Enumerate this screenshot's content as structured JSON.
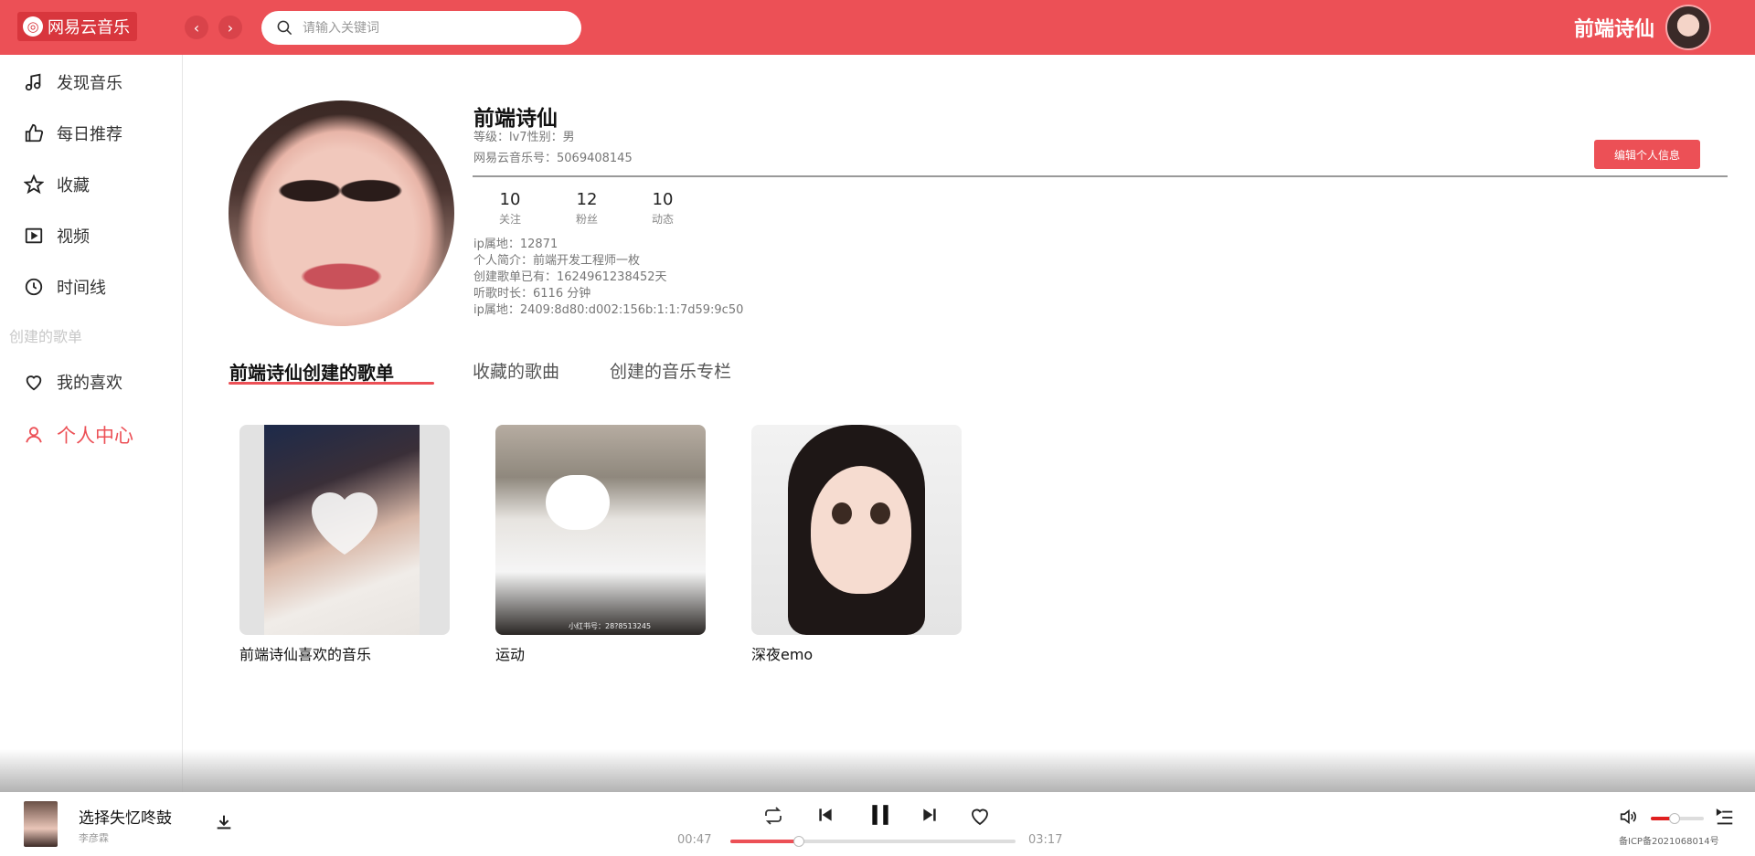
{
  "header": {
    "app_name": "网易云音乐",
    "search_placeholder": "请输入关键词",
    "username": "前端诗仙"
  },
  "sidebar": {
    "items": [
      {
        "label": "发现音乐",
        "icon": "music-note-icon"
      },
      {
        "label": "每日推荐",
        "icon": "thumbs-up-icon"
      },
      {
        "label": "收藏",
        "icon": "star-icon"
      },
      {
        "label": "视频",
        "icon": "video-icon"
      },
      {
        "label": "时间线",
        "icon": "clock-icon"
      }
    ],
    "section_title": "创建的歌单",
    "playlists": [
      {
        "label": "我的喜欢",
        "icon": "heart-icon"
      },
      {
        "label": "个人中心",
        "icon": "user-icon",
        "active": true
      }
    ]
  },
  "profile": {
    "name": "前端诗仙",
    "level_gender": "等级：lv7性别：男",
    "account_id": "网易云音乐号：5069408145",
    "edit_button": "编辑个人信息",
    "stats": [
      {
        "value": "10",
        "label": "关注"
      },
      {
        "value": "12",
        "label": "粉丝"
      },
      {
        "value": "10",
        "label": "动态"
      }
    ],
    "info": [
      "ip属地：12871",
      "个人简介：前端开发工程师一枚",
      "创建歌单已有：1624961238452天",
      "听歌时长：6116 分钟",
      "ip属地：2409:8d80:d002:156b:1:1:7d59:9c50"
    ]
  },
  "tabs": [
    {
      "label": "前端诗仙创建的歌单",
      "active": true
    },
    {
      "label": "收藏的歌曲"
    },
    {
      "label": "创建的音乐专栏"
    }
  ],
  "playlists": [
    {
      "title": "前端诗仙喜欢的音乐"
    },
    {
      "title": "运动",
      "watermark": "小红书号：28?8513245"
    },
    {
      "title": "深夜emo"
    }
  ],
  "player": {
    "song": "选择失忆咚鼓",
    "artist": "李彦霖",
    "current_time": "00:47",
    "total_time": "03:17",
    "progress": 0.24,
    "volume": 0.45,
    "icp": "备ICP备2021068014号"
  },
  "colors": {
    "accent": "#ec5056",
    "logo_bg": "#d8363d"
  }
}
